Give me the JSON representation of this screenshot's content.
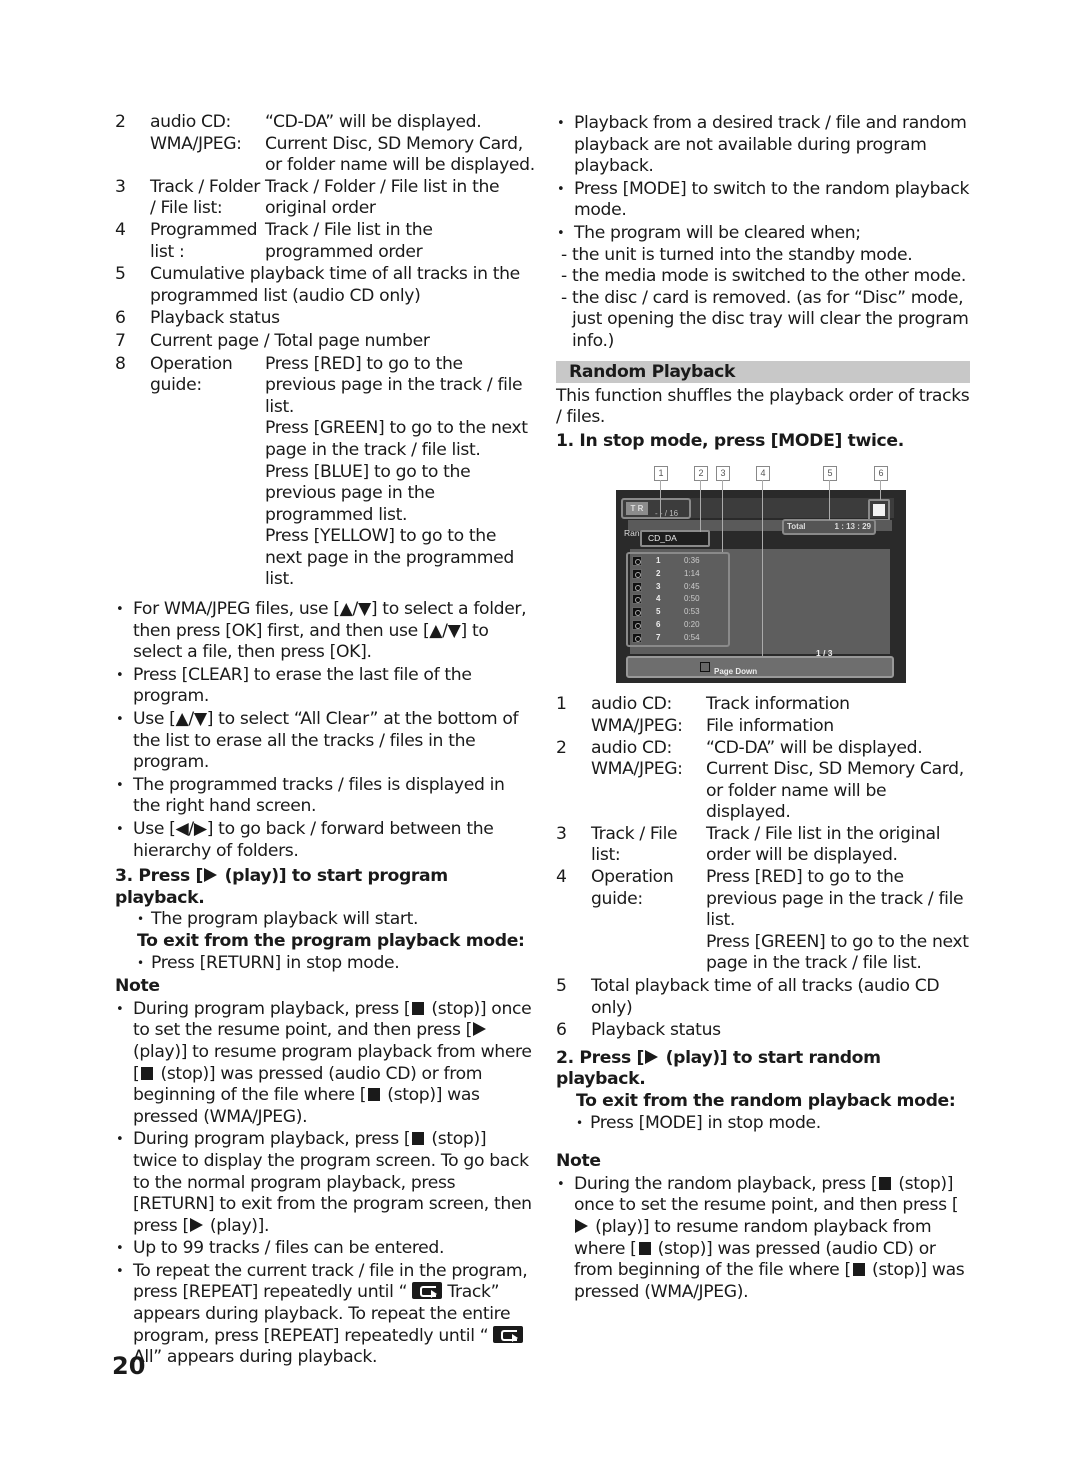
{
  "page_number": "20",
  "left": {
    "deflist_a": [
      {
        "num": "2",
        "rows": [
          {
            "term": "audio CD:",
            "def": "“CD-DA” will be displayed."
          },
          {
            "term": "WMA/JPEG:",
            "def": "Current Disc, SD Memory Card, or folder name will be displayed."
          }
        ]
      },
      {
        "num": "3",
        "rows": [
          {
            "term": "Track / Folder / File list:",
            "def": "Track / Folder / File list in the original order"
          }
        ]
      },
      {
        "num": "4",
        "rows": [
          {
            "term": "Programmed list :",
            "def": "Track / File list in the programmed order"
          }
        ]
      }
    ],
    "item5": {
      "num": "5",
      "text": "Cumulative playback time of all tracks in the programmed list (audio CD only)"
    },
    "item6": {
      "num": "6",
      "text": "Playback status"
    },
    "item7": {
      "num": "7",
      "text": "Current page / Total page number"
    },
    "item8": {
      "num": "8",
      "term": "Operation guide:",
      "defs": [
        "Press [RED] to go to the previous page in the track / file list.",
        "Press [GREEN] to go to the next page in the track / file list.",
        "Press [BLUE] to go to the previous page in the programmed list.",
        "Press [YELLOW] to go to the next page in the programmed list."
      ]
    },
    "bullets": [
      "For WMA/JPEG files, use [▲/▼] to select a folder, then press [OK] first, and then use [▲/▼] to select a file, then press [OK].",
      "Press [CLEAR] to erase the last file of the program.",
      "Use [▲/▼] to select “All Clear” at the bottom of the list to erase all the tracks / files in the program.",
      "The programmed tracks / files is displayed in the right hand screen.",
      "Use [◀/▶] to go back / forward between the hierarchy of folders."
    ],
    "step3": {
      "prefix": "3. Press [",
      "suffix": " (play)] to start program playback."
    },
    "step3_bullet": "The program playback will start.",
    "exit_heading": "To exit from the program playback mode:",
    "exit_bullet": "Press [RETURN] in stop mode.",
    "note_heading": "Note",
    "note1": {
      "a": "During program playback, press [",
      "b": " (stop)] once to set the resume point, and then press [",
      "c": " (play)] to resume program playback from where [",
      "d": " (stop)] was pressed (audio CD) or from beginning of the file where [",
      "e": " (stop)] was pressed (WMA/JPEG)."
    },
    "note2": {
      "a": "During program playback, press [",
      "b": " (stop)] twice to display the program screen. To go back to the normal program playback, press [RETURN] to exit from the program screen, then press [",
      "c": " (play)]."
    },
    "note3": "Up to 99 tracks / files can be entered.",
    "note4": {
      "a": "To repeat the current track / file in the program, press [REPEAT] repeatedly until “ ",
      "b": " Track” appears during playback. To repeat the entire program, press [REPEAT] repeatedly until “ ",
      "c": " All” appears during playback."
    }
  },
  "right": {
    "bullets": [
      "Playback from a desired track / file and random playback are not available during program playback.",
      "Press [MODE] to switch to the random playback mode.",
      "The program will be cleared when;"
    ],
    "dashes": [
      "the unit is turned into the standby mode.",
      "the media mode is switched to the other mode.",
      "the disc / card is removed. (as for “Disc” mode, just opening the disc tray will clear the program info.)"
    ],
    "section_title": "Random Playback",
    "intro": "This function shuffles the playback order of tracks / files.",
    "step1": "1. In stop mode, press [MODE] twice.",
    "osd": {
      "callouts": [
        "1",
        "2",
        "3",
        "4",
        "5",
        "6"
      ],
      "tr_badge": "T R",
      "tr_count": "- - / 16",
      "mode": "Random",
      "disc": "CD_DA",
      "total_label": "Total",
      "total_time": "1 : 13 : 29",
      "tracks": [
        {
          "n": "1",
          "t": "0:36"
        },
        {
          "n": "2",
          "t": "1:14"
        },
        {
          "n": "3",
          "t": "0:45"
        },
        {
          "n": "4",
          "t": "0:50"
        },
        {
          "n": "5",
          "t": "0:53"
        },
        {
          "n": "6",
          "t": "0:20"
        },
        {
          "n": "7",
          "t": "0:54"
        }
      ],
      "page": "1  /  3",
      "guide": "Page Down"
    },
    "deflist": [
      {
        "num": "1",
        "rows": [
          {
            "term": "audio CD:",
            "def": "Track information"
          },
          {
            "term": "WMA/JPEG:",
            "def": "File information"
          }
        ]
      },
      {
        "num": "2",
        "rows": [
          {
            "term": "audio CD:",
            "def": "“CD-DA” will be displayed."
          },
          {
            "term": "WMA/JPEG:",
            "def": "Current Disc, SD Memory Card, or folder name will be displayed."
          }
        ]
      },
      {
        "num": "3",
        "rows": [
          {
            "term": "Track / File list:",
            "def": "Track / File list in the original order will be displayed."
          }
        ]
      },
      {
        "num": "4",
        "rows": [
          {
            "term": "Operation guide:",
            "def": "Press [RED] to go to the previous page in the track / file list."
          },
          {
            "term": "",
            "def": "Press [GREEN] to go to the next page in the track / file list."
          }
        ]
      }
    ],
    "item5": {
      "num": "5",
      "text": "Total playback time of all tracks (audio CD only)"
    },
    "item6": {
      "num": "6",
      "text": "Playback status"
    },
    "step2": {
      "prefix": "2. Press [",
      "suffix": " (play)] to start random playback."
    },
    "exit_heading": "To exit from the random playback mode:",
    "exit_bullet": "Press [MODE] in stop mode.",
    "note_heading": "Note",
    "note1": {
      "a": "During the random playback, press [",
      "b": " (stop)] once to set the resume point, and then press [",
      "c": " (play)] to resume random playback from where [",
      "d": " (stop)] was pressed (audio CD) or from beginning of the file where [",
      "e": " (stop)] was pressed (WMA/JPEG)."
    }
  }
}
